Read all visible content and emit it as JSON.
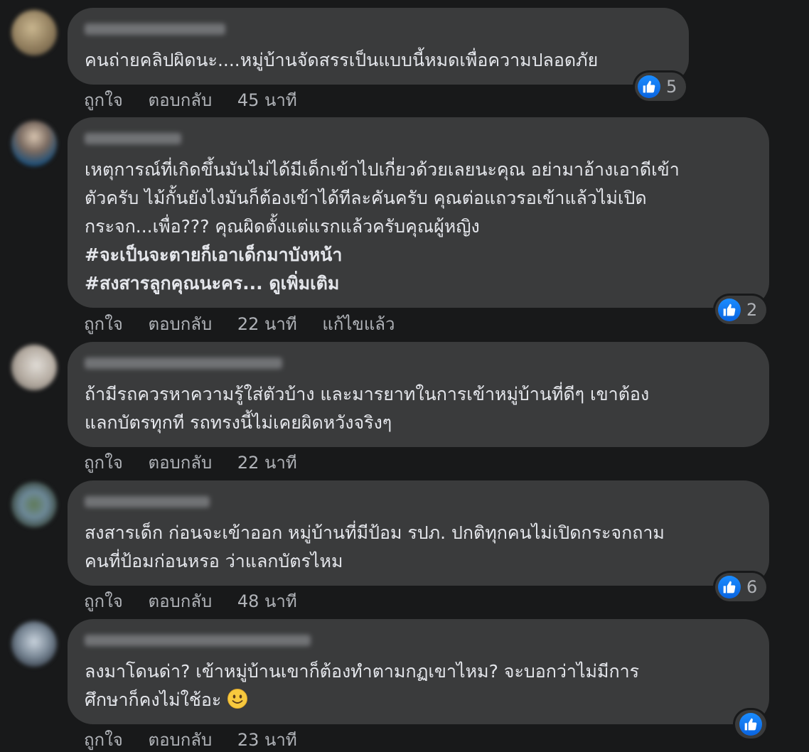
{
  "labels": {
    "like": "ถูกใจ",
    "reply": "ตอบกลับ"
  },
  "comments": [
    {
      "lines": [
        "คนถ่ายคลิปผิดนะ....หมู่บ้านจัดสรรเป็นแบบนี้หมดเพื่อความปลอดภัย"
      ],
      "time": "45 นาที",
      "reaction_count": "5"
    },
    {
      "lines": [
        "เหตุการณ์ที่เกิดขึ้นมันไม่ได้มีเด็กเข้าไปเกี่ยวด้วยเลยนะคุณ อย่ามาอ้างเอาดีเข้า",
        "ตัวครับ ไม้กั้นยังไงมันก็ต้องเข้าได้ทีละคันครับ คุณต่อแถวรอเข้าแล้วไม่เปิด",
        "กระจก...เพื่อ??? คุณผิดตั้งแต่แรกแล้วครับคุณผู้หญิง"
      ],
      "hashtag_1": "#จะเป็นจะตายก็เอาเด็กมาบังหน้า",
      "hashtag_2": "#สงสารลูกคุณนะคร...",
      "see_more": "ดูเพิ่มเติม",
      "time": "22 นาที",
      "edited": "แก้ไขแล้ว",
      "reaction_count": "2"
    },
    {
      "lines": [
        "ถ้ามีรถควรหาความรู้ใส่ตัวบ้าง และมารยาทในการเข้าหมู่บ้านที่ดีๆ เขาต้อง",
        "แลกบัตรทุกที รถทรงนี้ไม่เคยผิดหวังจริงๆ"
      ],
      "time": "22 นาที"
    },
    {
      "lines": [
        "สงสารเด็ก ก่อนจะเข้าออก หมู่บ้านที่มีป้อม รปภ. ปกติทุกคนไม่เปิดกระจกถาม",
        "คนที่ป้อมก่อนหรอ ว่าแลกบัตรไหม"
      ],
      "time": "48 นาที",
      "reaction_count": "6"
    },
    {
      "lines": [
        "ลงมาโดนด่า? เข้าหมู่บ้านเขาก็ต้องทำตามกฏเขาไหม? จะบอกว่าไม่มีการ",
        "ศึกษาก็คงไม่ใช้อะ"
      ],
      "time": "23 นาที",
      "emoji": "slightly-smiling-face-icon"
    }
  ],
  "colors": {
    "background": "#18191a",
    "bubble": "#3a3b3c",
    "text": "#e4e6eb",
    "secondary_text": "#b0b3b8",
    "like_blue": "#1877f2"
  }
}
